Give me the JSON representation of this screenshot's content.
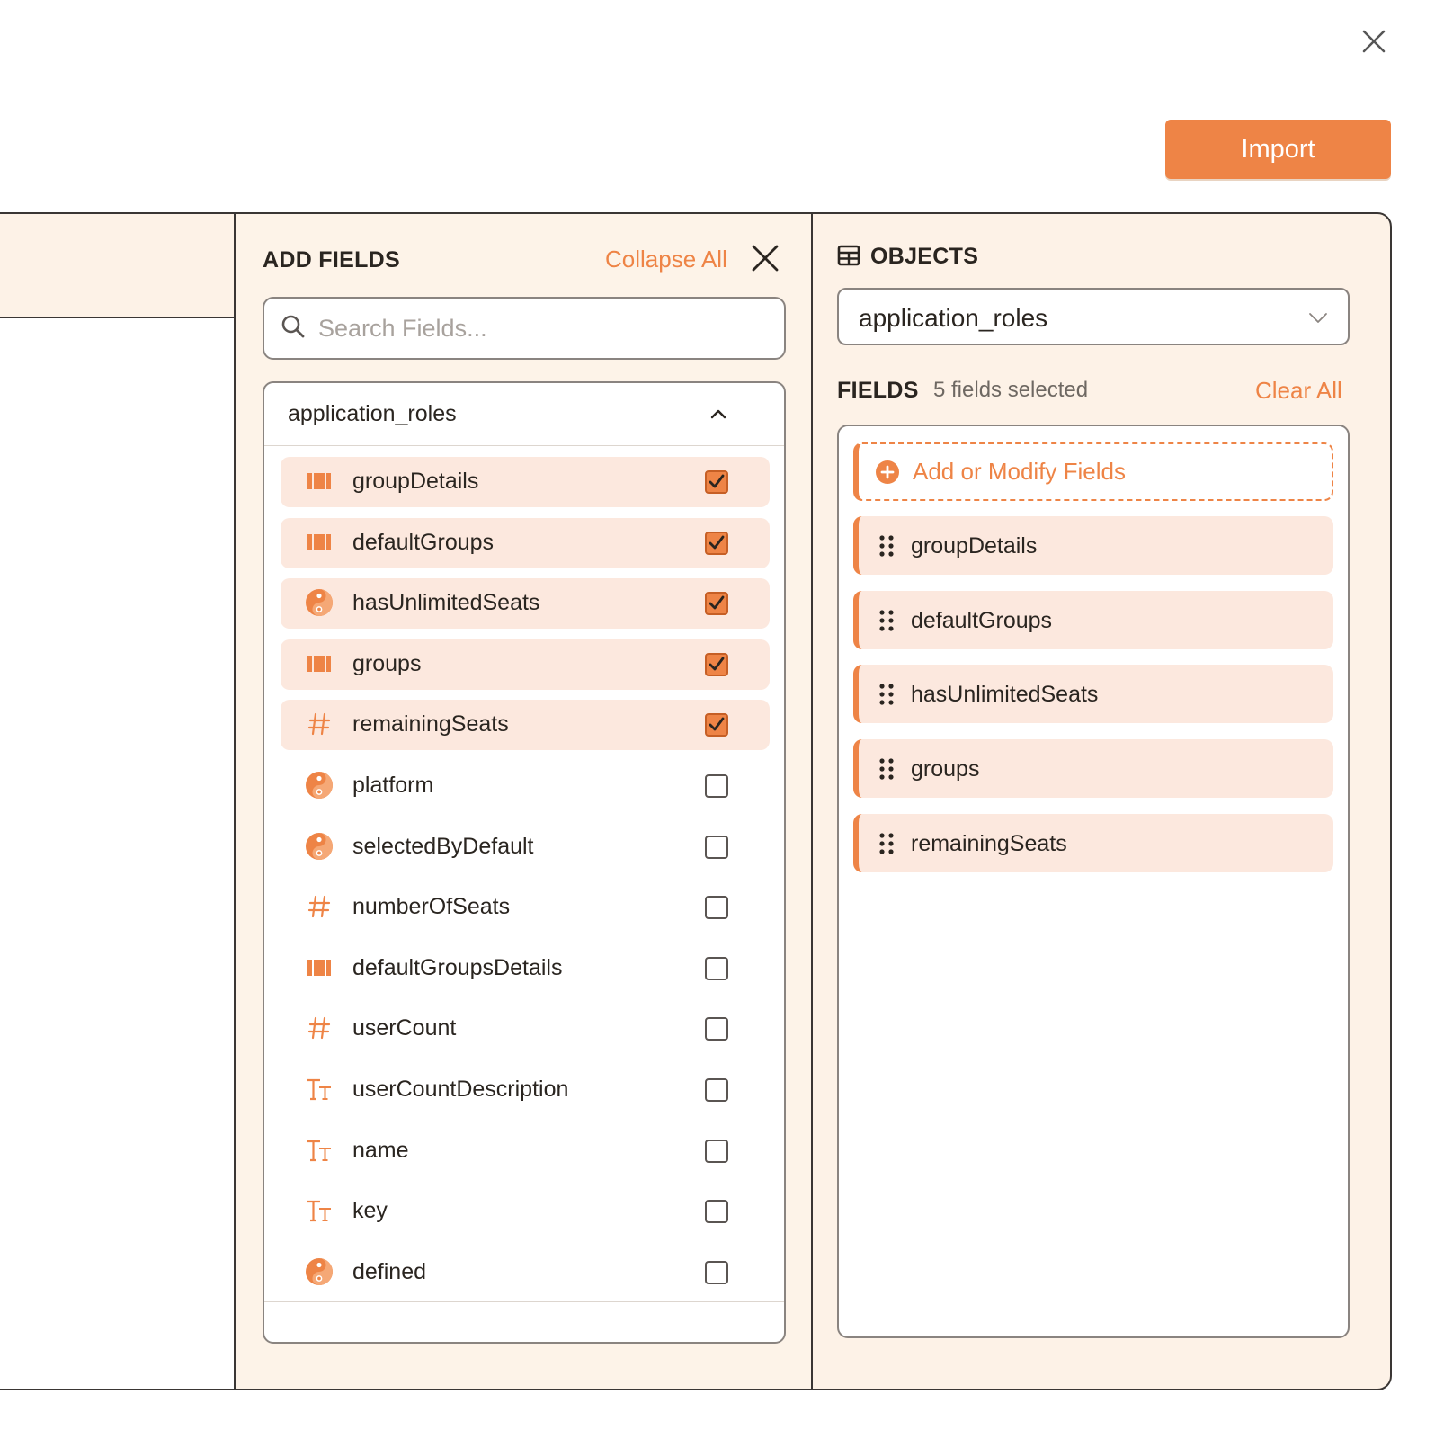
{
  "toolbar": {
    "import_label": "Import"
  },
  "add_fields": {
    "title": "ADD FIELDS",
    "collapse_all": "Collapse All",
    "search_placeholder": "Search Fields...",
    "group": {
      "name": "application_roles",
      "fields": [
        {
          "label": "groupDetails",
          "type": "array-icon",
          "checked": true
        },
        {
          "label": "defaultGroups",
          "type": "array-icon",
          "checked": true
        },
        {
          "label": "hasUnlimitedSeats",
          "type": "boolean-icon",
          "checked": true
        },
        {
          "label": "groups",
          "type": "array-icon",
          "checked": true
        },
        {
          "label": "remainingSeats",
          "type": "number-icon",
          "checked": true
        },
        {
          "label": "platform",
          "type": "boolean-icon",
          "checked": false
        },
        {
          "label": "selectedByDefault",
          "type": "boolean-icon",
          "checked": false
        },
        {
          "label": "numberOfSeats",
          "type": "number-icon",
          "checked": false
        },
        {
          "label": "defaultGroupsDetails",
          "type": "array-icon",
          "checked": false
        },
        {
          "label": "userCount",
          "type": "number-icon",
          "checked": false
        },
        {
          "label": "userCountDescription",
          "type": "text-icon",
          "checked": false
        },
        {
          "label": "name",
          "type": "text-icon",
          "checked": false
        },
        {
          "label": "key",
          "type": "text-icon",
          "checked": false
        },
        {
          "label": "defined",
          "type": "boolean-icon",
          "checked": false
        }
      ]
    }
  },
  "objects": {
    "title": "OBJECTS",
    "selected_object": "application_roles",
    "fields_title": "FIELDS",
    "fields_count": "5 fields selected",
    "clear_all": "Clear All",
    "add_modify": "Add or Modify Fields",
    "selected_fields": [
      "groupDetails",
      "defaultGroups",
      "hasUnlimitedSeats",
      "groups",
      "remainingSeats"
    ]
  },
  "colors": {
    "accent": "#ee8446",
    "panel_bg": "#fdf2e7",
    "selected_row": "#fce8de",
    "border": "#3a3634"
  }
}
